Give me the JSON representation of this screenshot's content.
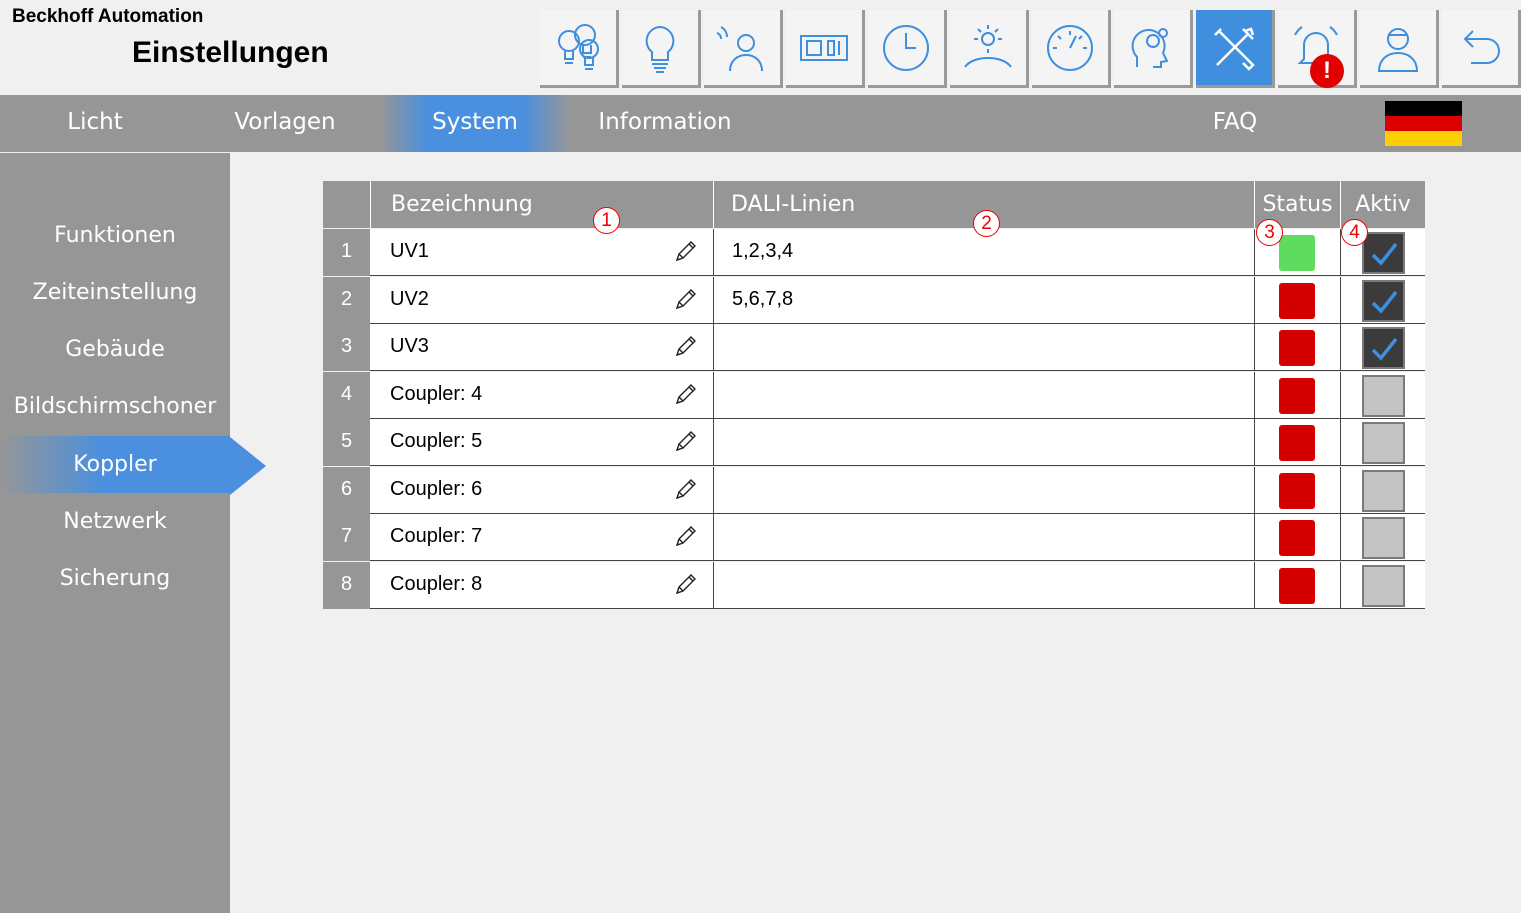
{
  "header": {
    "company": "Beckhoff Automation",
    "title": "Einstellungen",
    "alarm_badge": "!"
  },
  "toolbar": [
    {
      "icon": "bulbs-group-icon",
      "active": false
    },
    {
      "icon": "bulb-icon",
      "active": false
    },
    {
      "icon": "presence-sensor-icon",
      "active": false
    },
    {
      "icon": "light-switch-icon",
      "active": false
    },
    {
      "icon": "clock-icon",
      "active": false
    },
    {
      "icon": "daylight-icon",
      "active": false
    },
    {
      "icon": "gauge-icon",
      "active": false
    },
    {
      "icon": "settings-head-icon",
      "active": false
    },
    {
      "icon": "tools-icon",
      "active": true
    },
    {
      "icon": "alarm-bell-icon",
      "active": false
    },
    {
      "icon": "user-icon",
      "active": false
    },
    {
      "icon": "back-arrow-icon",
      "active": false
    }
  ],
  "nav": {
    "tabs": [
      {
        "label": "Licht",
        "active": false
      },
      {
        "label": "Vorlagen",
        "active": false
      },
      {
        "label": "System",
        "active": true
      },
      {
        "label": "Information",
        "active": false
      },
      {
        "label": "FAQ",
        "active": false
      }
    ],
    "flag_colors": [
      "#000000",
      "#dd0000",
      "#ffce00"
    ]
  },
  "sidebar": {
    "items": [
      {
        "label": "Funktionen",
        "active": false
      },
      {
        "label": "Zeiteinstellung",
        "active": false
      },
      {
        "label": "Gebäude",
        "active": false
      },
      {
        "label": "Bildschirmschoner",
        "active": false
      },
      {
        "label": "Koppler",
        "active": true
      },
      {
        "label": "Netzwerk",
        "active": false
      },
      {
        "label": "Sicherung",
        "active": false
      }
    ]
  },
  "table": {
    "columns": {
      "name": "Bezeichnung",
      "dali": "DALI-Linien",
      "status": "Status",
      "active": "Aktiv"
    },
    "markers": [
      "1",
      "2",
      "3",
      "4"
    ],
    "colors": {
      "status_ok": "#5fdc5f",
      "status_error": "#d40000"
    },
    "rows": [
      {
        "num": "1",
        "name": "UV1",
        "dali": "1,2,3,4",
        "status": "ok",
        "active": true
      },
      {
        "num": "2",
        "name": "UV2",
        "dali": "5,6,7,8",
        "status": "error",
        "active": true
      },
      {
        "num": "3",
        "name": "UV3",
        "dali": "",
        "status": "error",
        "active": true
      },
      {
        "num": "4",
        "name": "Coupler: 4",
        "dali": "",
        "status": "error",
        "active": false
      },
      {
        "num": "5",
        "name": "Coupler: 5",
        "dali": "",
        "status": "error",
        "active": false
      },
      {
        "num": "6",
        "name": "Coupler: 6",
        "dali": "",
        "status": "error",
        "active": false
      },
      {
        "num": "7",
        "name": "Coupler: 7",
        "dali": "",
        "status": "error",
        "active": false
      },
      {
        "num": "8",
        "name": "Coupler: 8",
        "dali": "",
        "status": "error",
        "active": false
      }
    ]
  }
}
